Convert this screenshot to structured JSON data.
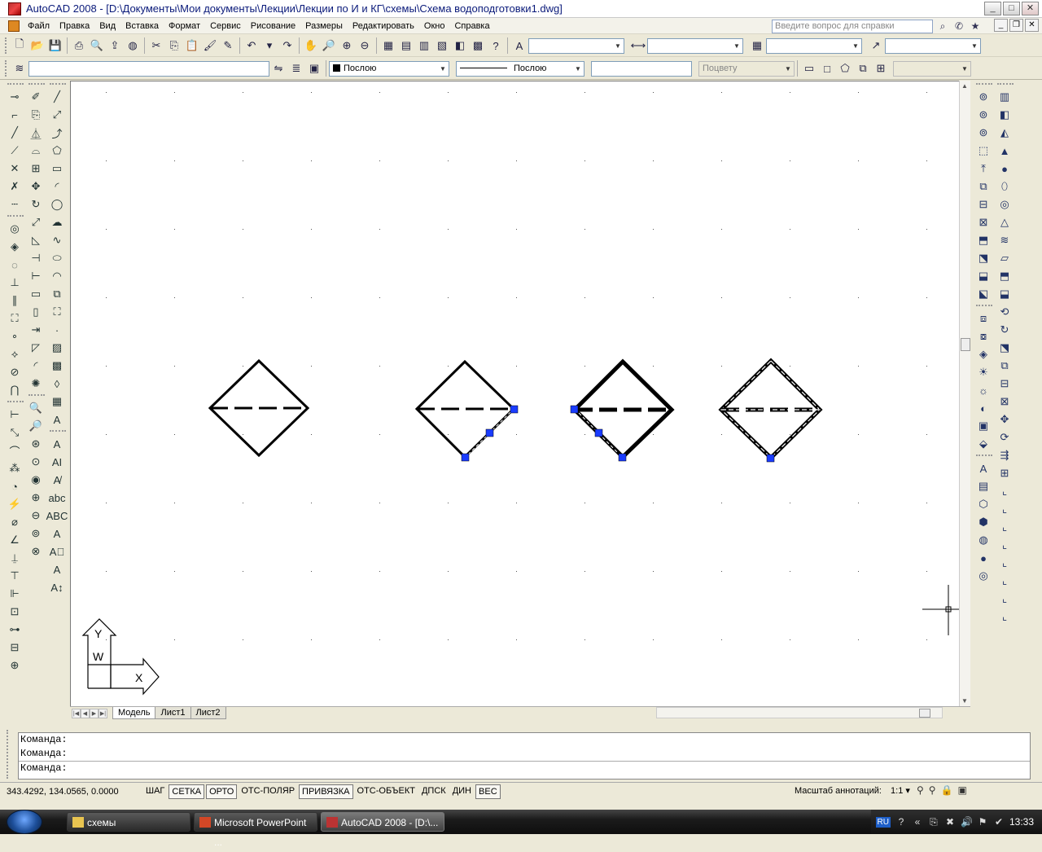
{
  "window": {
    "title": "AutoCAD 2008 - [D:\\Документы\\Мои документы\\Лекции\\Лекции по И и КГ\\схемы\\Схема водоподготовки1.dwg]",
    "controls": [
      "_",
      "□",
      "✕"
    ]
  },
  "menu": {
    "items": [
      "Файл",
      "Правка",
      "Вид",
      "Вставка",
      "Формат",
      "Сервис",
      "Рисование",
      "Размеры",
      "Редактировать",
      "Окно",
      "Справка"
    ],
    "help_placeholder": "Введите вопрос для справки"
  },
  "properties": {
    "layer": "",
    "color": "Послою",
    "linetype": "Послою",
    "lineweight": "",
    "plotstyle": "Поцвету"
  },
  "tabs": [
    "Модель",
    "Лист1",
    "Лист2"
  ],
  "active_tab": "Модель",
  "ucs": {
    "x_label": "X",
    "y_label": "Y",
    "w_label": "W"
  },
  "command": {
    "history": [
      "Команда:",
      "Команда:"
    ],
    "prompt": "Команда:"
  },
  "status": {
    "coords": "343.4292, 134.0565, 0.0000",
    "buttons": [
      {
        "label": "ШАГ",
        "on": false
      },
      {
        "label": "СЕТКА",
        "on": true
      },
      {
        "label": "ОРТО",
        "on": true
      },
      {
        "label": "ОТС-ПОЛЯР",
        "on": false
      },
      {
        "label": "ПРИВЯЗКА",
        "on": true
      },
      {
        "label": "ОТС-ОБЪЕКТ",
        "on": false
      },
      {
        "label": "ДПСК",
        "on": false
      },
      {
        "label": "ДИН",
        "on": false
      },
      {
        "label": "ВЕС",
        "on": true
      }
    ],
    "annotation_scale_label": "Масштаб аннотаций:",
    "annotation_scale": "1:1"
  },
  "taskbar": {
    "items": [
      {
        "label": "схемы",
        "active": false
      },
      {
        "label": "Microsoft PowerPoint ...",
        "active": false
      },
      {
        "label": "AutoCAD 2008 - [D:\\...",
        "active": true
      }
    ],
    "lang": "RU",
    "time": "13:33"
  },
  "colors": {
    "grip": "#1a3cff",
    "titlebar_text": "#0a1a7a",
    "canvas": "#ffffff"
  }
}
